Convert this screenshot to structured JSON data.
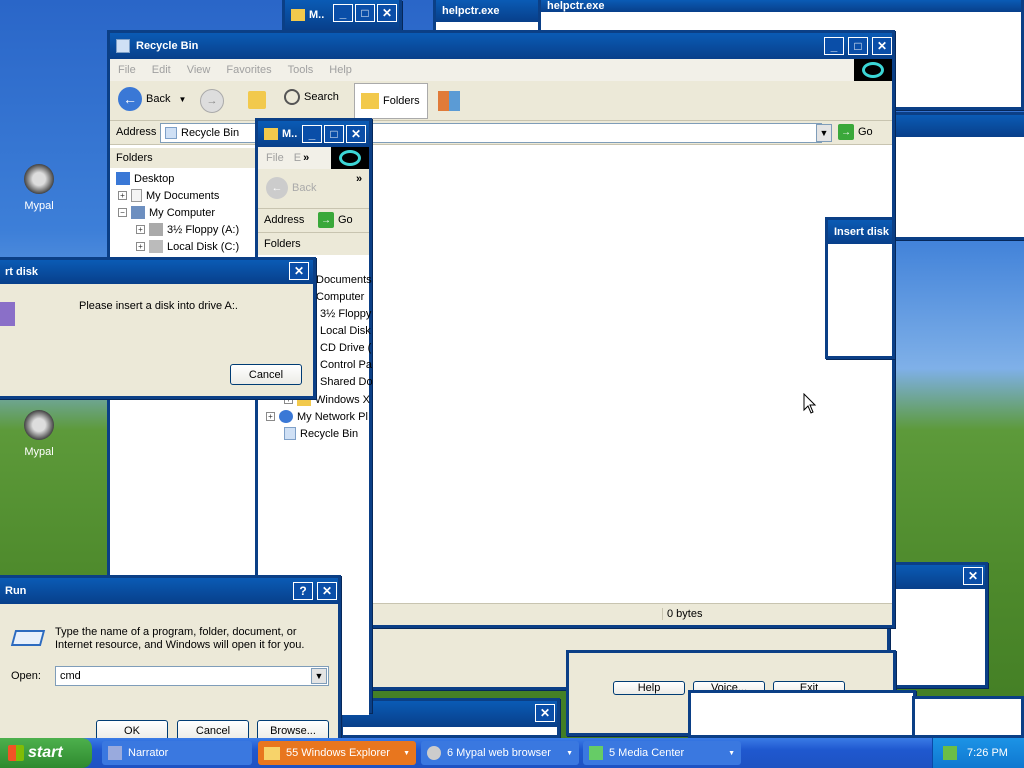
{
  "desktop": {
    "icons": [
      {
        "label": "Mypal"
      },
      {
        "label": "Mypal"
      }
    ]
  },
  "bg_windows": {
    "top_small_title": "M..",
    "helpctr1": "helpctr.exe",
    "helpctr2": "helpctr.exe"
  },
  "recycle_bin": {
    "title": "Recycle Bin",
    "menu": [
      "File",
      "Edit",
      "View",
      "Favorites",
      "Tools",
      "Help"
    ],
    "toolbar": {
      "back": "Back",
      "search": "Search",
      "folders": "Folders"
    },
    "address_label": "Address",
    "address_value": "Recycle Bin",
    "go": "Go",
    "folders_header": "Folders",
    "tree": [
      "Desktop",
      "My Documents",
      "My Computer",
      "3½ Floppy (A:)",
      "Local Disk (C:)"
    ],
    "status_size": "0 bytes"
  },
  "mypal_window": {
    "title": "M..",
    "menu": [
      "File",
      "E"
    ],
    "back": "Back",
    "address_label": "Address",
    "go": "Go",
    "folders_header": "Folders",
    "tree": [
      "p",
      "Documents",
      "Computer",
      "3½ Floppy",
      "Local Disk",
      "CD Drive (",
      "Control Pa",
      "Shared Do",
      "Windows X",
      "My Network Pl",
      "Recycle Bin"
    ]
  },
  "insert_disk_dialog": {
    "title": "rt disk",
    "message": "Please insert a disk into drive A:.",
    "cancel": "Cancel"
  },
  "insert_disk_small": {
    "title": "Insert disk"
  },
  "run_dialog": {
    "title": "Run",
    "description_line1": "Type the name of a program, folder, document, or",
    "description_line2": "Internet resource, and Windows will open it for you.",
    "open_label": "Open:",
    "open_value": "cmd",
    "ok": "OK",
    "cancel": "Cancel",
    "browse": "Browse..."
  },
  "back_dialog_buttons": [
    "Help",
    "Voice...",
    "Exit"
  ],
  "taskbar": {
    "start": "start",
    "items": [
      {
        "label": "Narrator"
      },
      {
        "label": "55 Windows Explorer"
      },
      {
        "label": "6 Mypal web browser"
      },
      {
        "label": "5 Media Center"
      }
    ],
    "clock": "7:26 PM"
  },
  "colors": {
    "title_bar": "#0a4ea8",
    "taskbar": "#245edb",
    "start": "#3c9a3c",
    "active_task": "#e8761e"
  }
}
